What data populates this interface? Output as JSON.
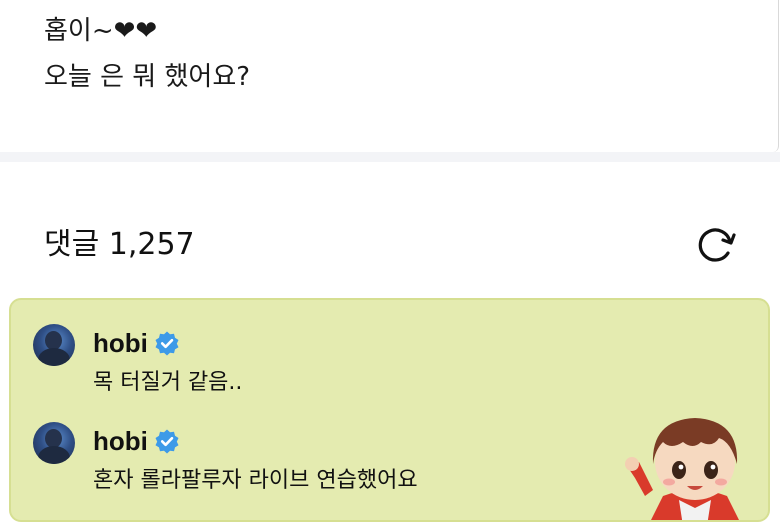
{
  "post": {
    "line1": "홉이~❤❤",
    "line2": "오늘 은 뭐 했어요?"
  },
  "comments_header": {
    "label": "댓글 1,257",
    "refresh_icon": "refresh-icon"
  },
  "colors": {
    "comment_bg": "#e4ebb0",
    "verified_badge": "#3d9ae8"
  },
  "comments": [
    {
      "username": "hobi",
      "verified": true,
      "text": "목 터질거 같음.."
    },
    {
      "username": "hobi",
      "verified": true,
      "text": "혼자 롤라팔루자 라이브 연습했어요"
    }
  ]
}
